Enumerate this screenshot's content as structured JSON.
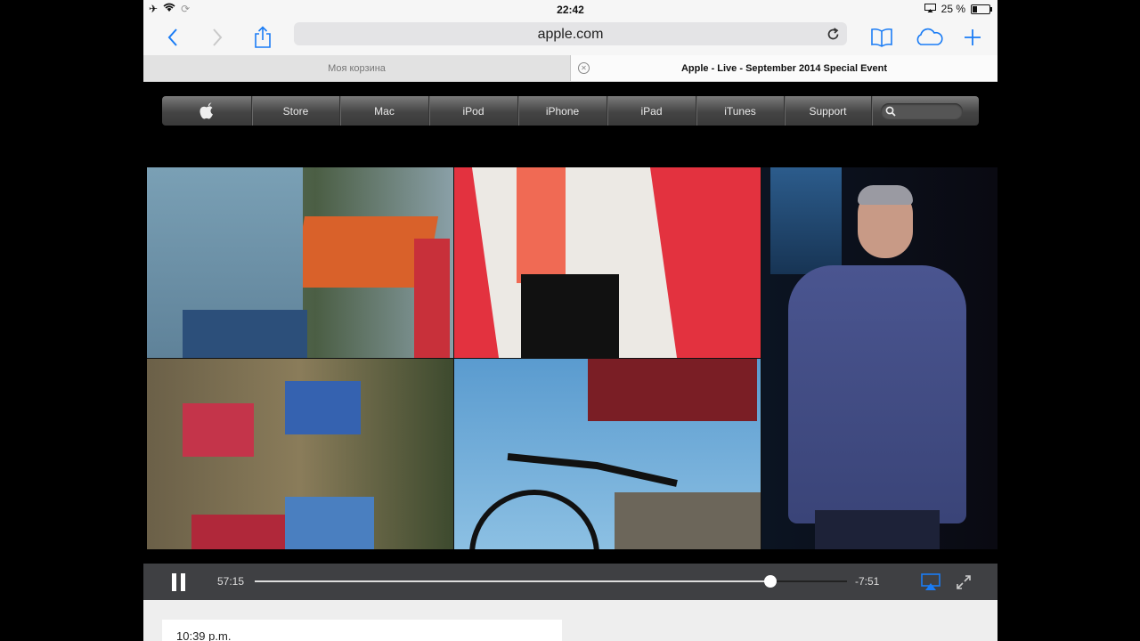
{
  "status_bar": {
    "time": "22:42",
    "battery": "25 %",
    "battery_level": 0.25
  },
  "toolbar": {
    "url": "apple.com"
  },
  "tabs": [
    {
      "title": "Моя корзина"
    },
    {
      "title": "Apple - Live - September 2014 Special Event"
    }
  ],
  "apple_nav": {
    "items": [
      "Store",
      "Mac",
      "iPod",
      "iPhone",
      "iPad",
      "iTunes",
      "Support"
    ]
  },
  "player": {
    "elapsed": "57:15",
    "remaining": "-7:51",
    "progress": 0.87
  },
  "live_blog": {
    "timestamp": "10:39 p.m."
  },
  "colors": {
    "accent": "#1a7cf5",
    "nav_dark": "#444444",
    "hero_red": "#e3323f"
  }
}
